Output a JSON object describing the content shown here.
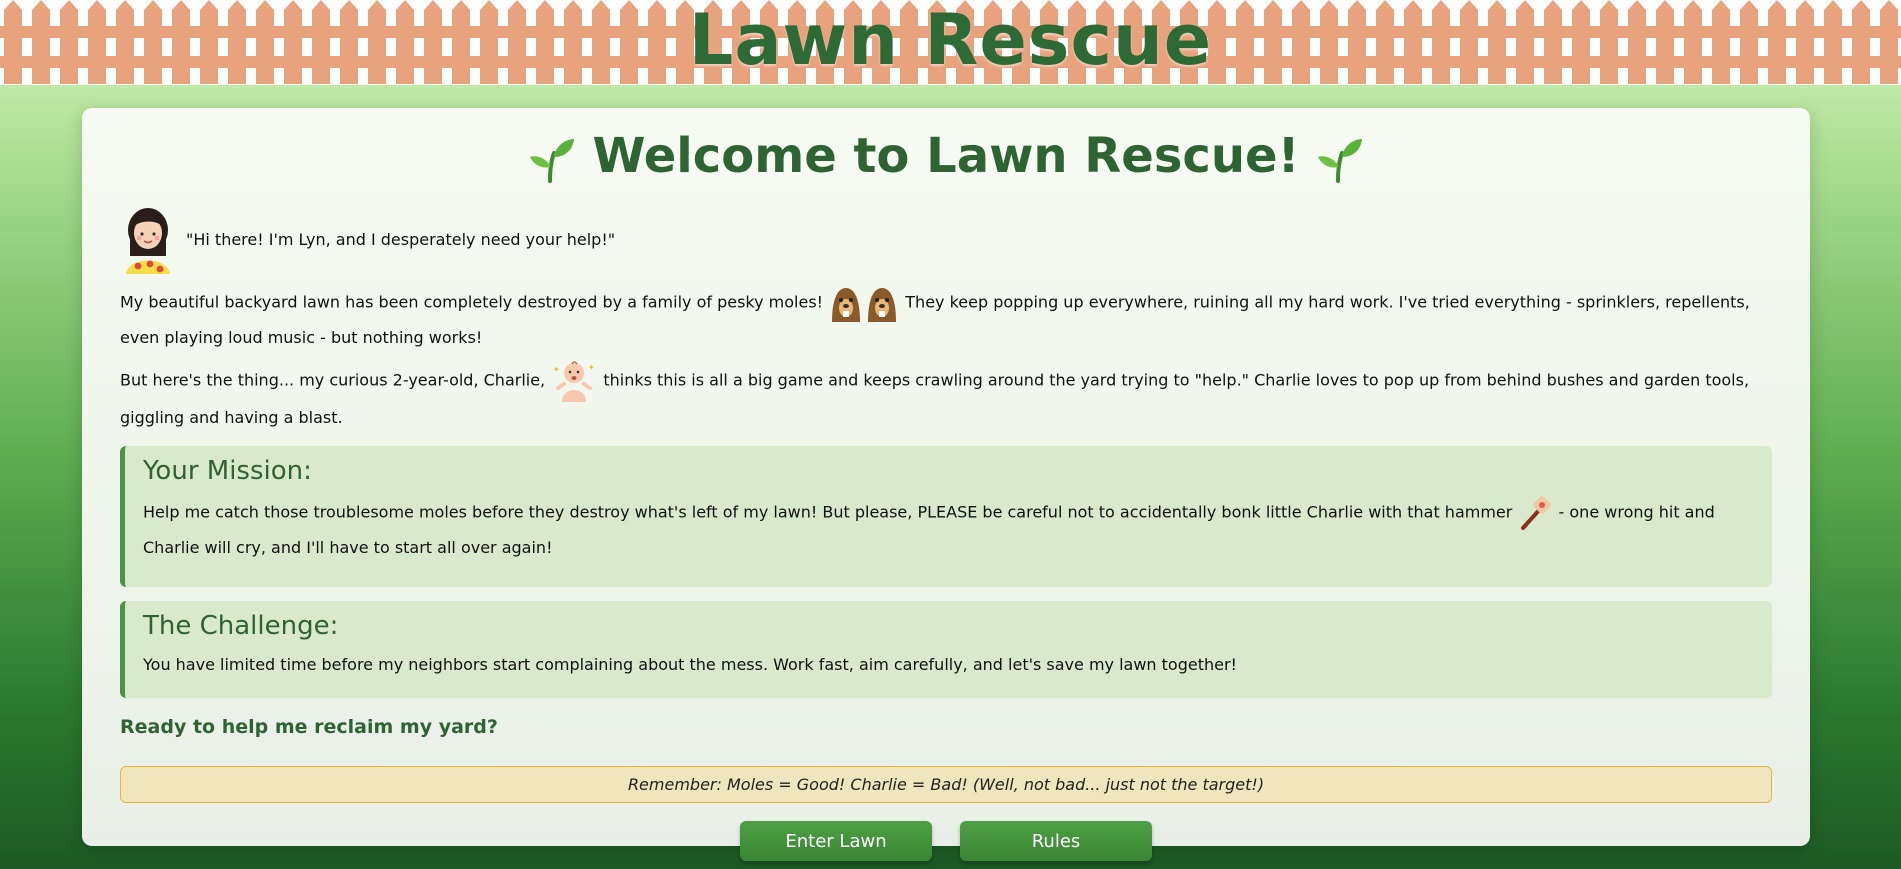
{
  "header": {
    "title": "Lawn Rescue"
  },
  "welcome": {
    "title": "Welcome to Lawn Rescue!",
    "icon": "seedling-icon"
  },
  "intro": {
    "quote": "\"Hi there! I'm Lyn, and I desperately need your help!\"",
    "avatar": "woman-icon"
  },
  "story": {
    "p1_a": "My beautiful backyard lawn has been completely destroyed by a family of pesky moles!",
    "p1_b": "They keep popping up everywhere, ruining all my hard work. I've tried everything - sprinklers, repellents, even playing loud music - but nothing works!",
    "p2_a": "But here's the thing... my curious 2-year-old, Charlie,",
    "p2_b": "thinks this is all a big game and keeps crawling around the yard trying to \"help.\" Charlie loves to pop up from behind bushes and garden tools, giggling and having a blast."
  },
  "mission": {
    "heading": "Your Mission:",
    "text_a": "Help me catch those troublesome moles before they destroy what's left of my lawn! But please, PLEASE be careful not to accidentally bonk little Charlie with that hammer",
    "text_b": "- one wrong hit and Charlie will cry, and I'll have to start all over again!"
  },
  "challenge": {
    "heading": "The Challenge:",
    "text": "You have limited time before my neighbors start complaining about the mess. Work fast, aim carefully, and let's save my lawn together!"
  },
  "ready": "Ready to help me reclaim my yard?",
  "reminder": "Remember: Moles = Good! Charlie = Bad! (Well, not bad... just not the target!)",
  "buttons": {
    "enter": "Enter Lawn",
    "rules": "Rules"
  },
  "colors": {
    "accent_green": "#2e6432",
    "button_green": "#4ea044",
    "fence": "#e8a27e",
    "reminder_bg": "#f0e6bd"
  }
}
